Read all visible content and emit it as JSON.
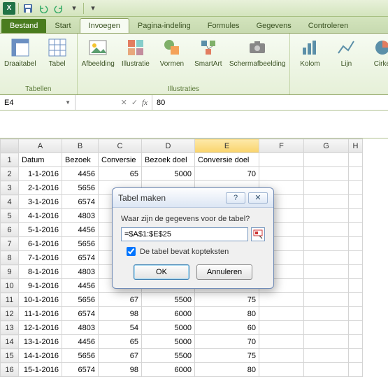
{
  "qat": {
    "app": "X"
  },
  "tabs": {
    "file": "Bestand",
    "items": [
      "Start",
      "Invoegen",
      "Pagina-indeling",
      "Formules",
      "Gegevens",
      "Controleren"
    ],
    "active_index": 1
  },
  "ribbon": {
    "groups": [
      {
        "label": "Tabellen",
        "buttons": [
          "Draaitabel",
          "Tabel"
        ]
      },
      {
        "label": "Illustraties",
        "buttons": [
          "Afbeelding",
          "Illustratie",
          "Vormen",
          "SmartArt",
          "Schermafbeelding"
        ]
      },
      {
        "label": "",
        "buttons": [
          "Kolom",
          "Lijn",
          "Cirkel"
        ]
      }
    ]
  },
  "namebox": "E4",
  "formula_value": "80",
  "columns": [
    "A",
    "B",
    "C",
    "D",
    "E",
    "F",
    "G",
    "H"
  ],
  "headers": [
    "Datum",
    "Bezoek",
    "Conversie",
    "Bezoek doel",
    "Conversie doel"
  ],
  "rows": [
    {
      "n": 2,
      "d": "1-1-2016",
      "b": 4456,
      "c": 65,
      "bd": 5000,
      "cd": 70
    },
    {
      "n": 3,
      "d": "2-1-2016",
      "b": 5656,
      "c": null,
      "bd": null,
      "cd": null
    },
    {
      "n": 4,
      "d": "3-1-2016",
      "b": 6574,
      "c": null,
      "bd": null,
      "cd": null
    },
    {
      "n": 5,
      "d": "4-1-2016",
      "b": 4803,
      "c": null,
      "bd": null,
      "cd": null
    },
    {
      "n": 6,
      "d": "5-1-2016",
      "b": 4456,
      "c": null,
      "bd": null,
      "cd": null
    },
    {
      "n": 7,
      "d": "6-1-2016",
      "b": 5656,
      "c": null,
      "bd": null,
      "cd": null
    },
    {
      "n": 8,
      "d": "7-1-2016",
      "b": 6574,
      "c": null,
      "bd": null,
      "cd": null
    },
    {
      "n": 9,
      "d": "8-1-2016",
      "b": 4803,
      "c": null,
      "bd": null,
      "cd": null
    },
    {
      "n": 10,
      "d": "9-1-2016",
      "b": 4456,
      "c": null,
      "bd": null,
      "cd": null
    },
    {
      "n": 11,
      "d": "10-1-2016",
      "b": 5656,
      "c": 67,
      "bd": 5500,
      "cd": 75
    },
    {
      "n": 12,
      "d": "11-1-2016",
      "b": 6574,
      "c": 98,
      "bd": 6000,
      "cd": 80
    },
    {
      "n": 13,
      "d": "12-1-2016",
      "b": 4803,
      "c": 54,
      "bd": 5000,
      "cd": 60
    },
    {
      "n": 14,
      "d": "13-1-2016",
      "b": 4456,
      "c": 65,
      "bd": 5000,
      "cd": 70
    },
    {
      "n": 15,
      "d": "14-1-2016",
      "b": 5656,
      "c": 67,
      "bd": 5500,
      "cd": 75
    },
    {
      "n": 16,
      "d": "15-1-2016",
      "b": 6574,
      "c": 98,
      "bd": 6000,
      "cd": 80
    }
  ],
  "dialog": {
    "title": "Tabel maken",
    "question": "Waar zijn de gegevens voor de tabel?",
    "range": "=$A$1:$E$25",
    "checkbox_label": "De tabel bevat kopteksten",
    "checked": true,
    "ok": "OK",
    "cancel": "Annuleren"
  }
}
